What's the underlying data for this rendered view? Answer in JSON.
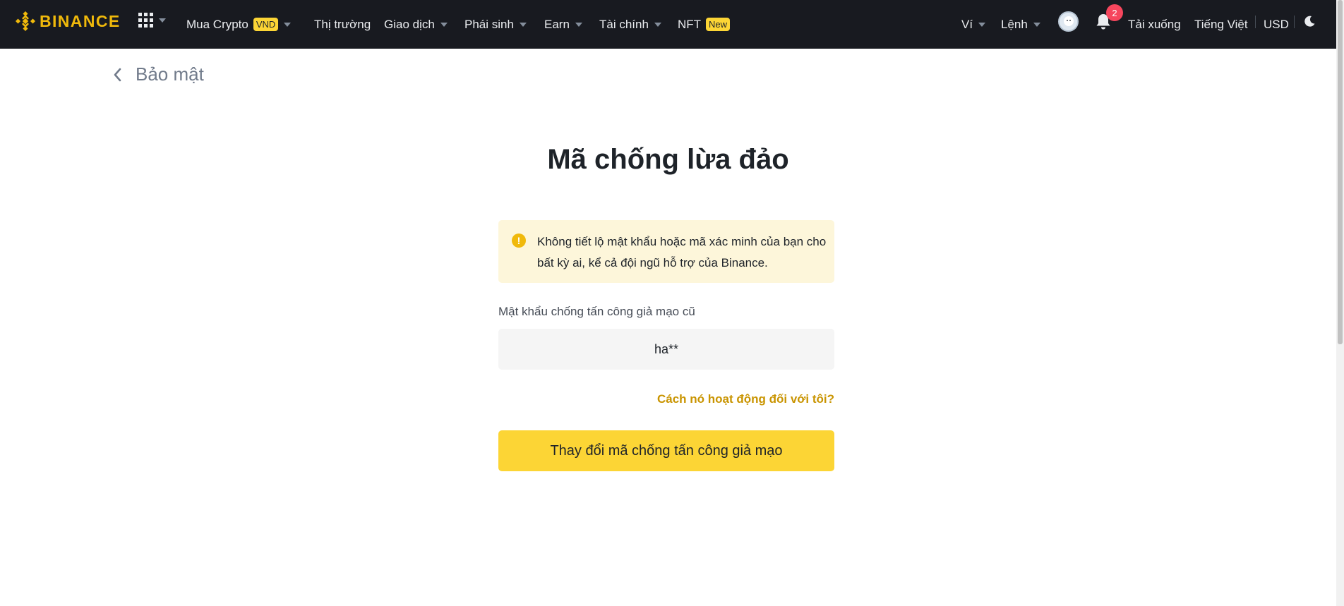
{
  "brand": {
    "name": "BINANCE",
    "color": "#f0b90b"
  },
  "nav": {
    "apps_icon": "grid-icon",
    "items": [
      {
        "label": "Mua Crypto",
        "badge": "VND",
        "dropdown": true
      },
      {
        "label": "Thị trường",
        "dropdown": false
      },
      {
        "label": "Giao dịch",
        "dropdown": true
      },
      {
        "label": "Phái sinh",
        "dropdown": true
      },
      {
        "label": "Earn",
        "dropdown": true
      },
      {
        "label": "Tài chính",
        "dropdown": true
      },
      {
        "label": "NFT",
        "badge": "New",
        "dropdown": false
      }
    ],
    "right": {
      "wallet": "Ví",
      "orders": "Lệnh",
      "notifications_count": "2",
      "download": "Tải xuống",
      "language": "Tiếng Việt",
      "currency": "USD"
    }
  },
  "back": {
    "label": "Bảo mật"
  },
  "page": {
    "title": "Mã chống lừa đảo",
    "warning": "Không tiết lộ mật khẩu hoặc mã xác minh của bạn cho bất kỳ ai, kể cả đội ngũ hỗ trợ của Binance.",
    "field_label": "Mật khẩu chống tấn công giả mạo cũ",
    "field_value": "ha**",
    "how_link": "Cách nó hoạt động đối với tôi?",
    "primary_button": "Thay đổi mã chống tấn công giả mạo"
  },
  "colors": {
    "accent": "#fcd535",
    "topbar": "#181a20",
    "warning_bg": "#fdf6da",
    "link": "#c99400",
    "notification": "#f6465d"
  }
}
